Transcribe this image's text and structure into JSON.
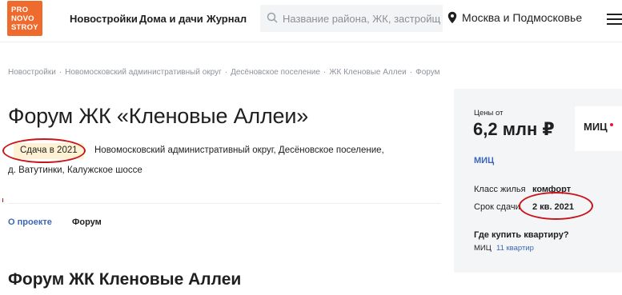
{
  "header": {
    "logo_lines": [
      "PRO",
      "NOVO",
      "STROY"
    ],
    "nav": [
      "Новостройки",
      "Дома и дачи",
      "Журнал"
    ],
    "search_placeholder": "Название района, ЖК, застройщика",
    "region": "Москва и Подмосковье"
  },
  "breadcrumb": [
    "Новостройки",
    "Новомосковский административный округ",
    "Десёновское поселение",
    "ЖК Кленовые Аллеи",
    "Форум"
  ],
  "page": {
    "title": "Форум ЖК «Кленовые Аллеи»",
    "completion_badge": "Сдача в 2021",
    "address_line1": "Новомосковский административный округ, Десёновское поселение,",
    "address_line2": "д. Ватутинки, Калужское шоссе",
    "tabs": [
      "О проекте",
      "Форум"
    ],
    "section_title": "Форум ЖК Кленовые Аллеи"
  },
  "card": {
    "price_label": "Цены от",
    "price": "6,2 млн ₽",
    "developer_logo": "МИЦ",
    "developer_link": "МИЦ",
    "class_label": "Класс жилья",
    "class_value": "комфорт",
    "deadline_label": "Срок сдачи",
    "deadline_value": "2 кв. 2021",
    "buy_question": "Где купить квартиру?",
    "buy_developer": "МИЦ",
    "buy_count": "11 квартир"
  },
  "colors": {
    "brand": "#ef6b2d",
    "link": "#3b67b6",
    "annotation": "#c8141b",
    "badge_bg": "#fff2d4"
  }
}
